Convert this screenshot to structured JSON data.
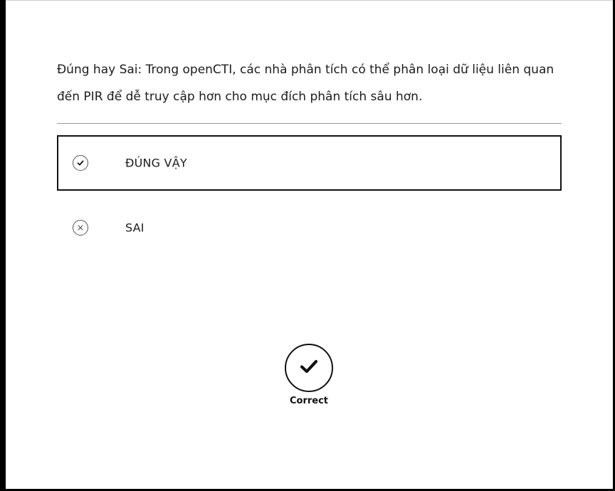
{
  "question": {
    "text": "Đúng hay Sai: Trong openCTI, các nhà phân tích có thể phân loại dữ liệu liên quan đến PIR để dễ truy cập hơn cho mục đích phân tích sâu hơn."
  },
  "options": [
    {
      "label": "ĐÚNG VẬY",
      "icon": "check-circle-icon",
      "selected": true
    },
    {
      "label": "SAI",
      "icon": "x-circle-icon",
      "selected": false
    }
  ],
  "result": {
    "icon": "check-icon",
    "label": "Correct"
  },
  "colors": {
    "background": "#ffffff",
    "outer": "#000000",
    "text": "#1c1c1c",
    "divider": "#9a9a9a",
    "selected_border": "#111111"
  }
}
